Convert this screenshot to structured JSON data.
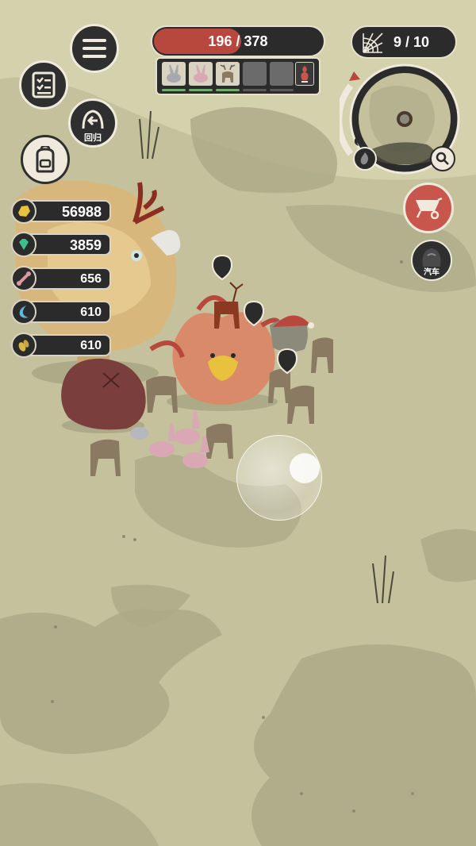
{
  "colors": {
    "ground": "#c4c19c",
    "ground_shadow": "#a9a685",
    "panel_dark": "#2b2b2b",
    "panel_border": "#e7e1cf",
    "hp_fill": "#b8483e",
    "cart_button": "#c9564c"
  },
  "top_left_menu": {
    "menu_icon": "hamburger-icon",
    "quest_icon": "quest-checklist-icon",
    "return_label": "回归",
    "bag_icon": "backpack-icon"
  },
  "health": {
    "current": 196,
    "max": 378,
    "separator": "/"
  },
  "party_slots": [
    {
      "creature": "rabbit",
      "filled": true,
      "hp_fraction": 1.0
    },
    {
      "creature": "rabbit",
      "filled": true,
      "hp_fraction": 1.0
    },
    {
      "creature": "deer",
      "filled": true,
      "hp_fraction": 1.0
    },
    {
      "creature": "",
      "filled": false,
      "hp_fraction": 0
    },
    {
      "creature": "",
      "filled": false,
      "hp_fraction": 0
    },
    {
      "creature": "special",
      "filled": true,
      "hp_fraction": 0
    }
  ],
  "web_counter": {
    "icon": "spider-web-icon",
    "value": "9 / 10"
  },
  "resources": [
    {
      "name": "gold",
      "icon": "gold-nugget-icon",
      "color": "#e8c23c",
      "value": "56988"
    },
    {
      "name": "gem",
      "icon": "green-gem-icon",
      "color": "#3fc08a",
      "value": "3859"
    },
    {
      "name": "bone",
      "icon": "bone-icon",
      "color": "#d99aa0",
      "value": "656"
    },
    {
      "name": "crescent",
      "icon": "crescent-fang-icon",
      "color": "#5fb8d8",
      "value": "610"
    },
    {
      "name": "seed",
      "icon": "seed-icon",
      "color": "#d7b64a",
      "value": "610"
    }
  ],
  "right_buttons": {
    "cart_icon": "wheelbarrow-icon",
    "car_label": "汽车"
  },
  "joystick": {
    "state": "idle"
  }
}
